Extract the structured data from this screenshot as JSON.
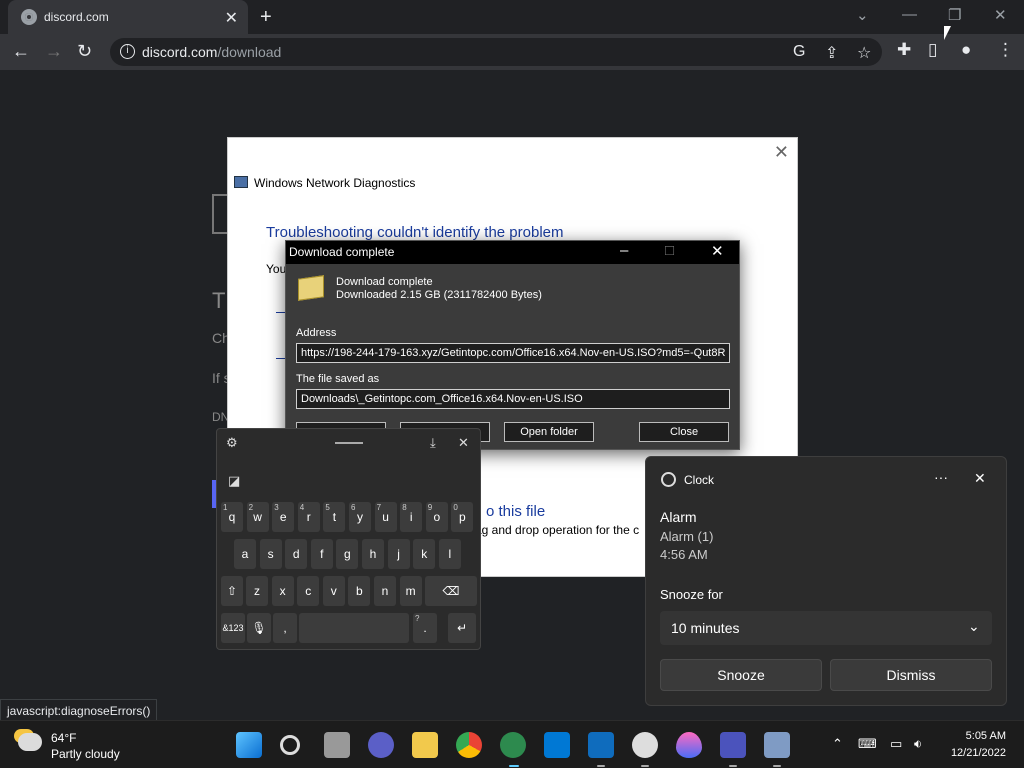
{
  "browser": {
    "tab_title": "discord.com",
    "url_host": "discord.com",
    "url_path": "/download",
    "colors": {
      "frame": "#202124",
      "toolbar": "#35363a"
    }
  },
  "diagnostics": {
    "title": "Windows Network Diagnostics",
    "heading": "Troubleshooting couldn't identify the problem",
    "body_start": "You",
    "link_text": "o this file",
    "drag_text": "rag and drop operation for the c"
  },
  "page_fragments": {
    "a": "T",
    "b": "Ch",
    "c": "If s",
    "d": "DN"
  },
  "download": {
    "title": "Download complete",
    "status": "Download complete",
    "detail": "Downloaded 2.15  GB (2311782400 Bytes)",
    "address_label": "Address",
    "address_value": "https://198-244-179-163.xyz/Getintopc.com/Office16.x64.Nov-en-US.ISO?md5=-Qut8R",
    "saved_label": "The file saved as",
    "saved_value": "Downloads\\_Getintopc.com_Office16.x64.Nov-en-US.ISO",
    "open_folder_label": "Open folder",
    "close_label": "Close"
  },
  "keyboard": {
    "row1": [
      {
        "k": "q",
        "n": "1"
      },
      {
        "k": "w",
        "n": "2"
      },
      {
        "k": "e",
        "n": "3"
      },
      {
        "k": "r",
        "n": "4"
      },
      {
        "k": "t",
        "n": "5"
      },
      {
        "k": "y",
        "n": "6"
      },
      {
        "k": "u",
        "n": "7"
      },
      {
        "k": "i",
        "n": "8"
      },
      {
        "k": "o",
        "n": "9"
      },
      {
        "k": "p",
        "n": "0"
      }
    ],
    "row2": [
      "a",
      "s",
      "d",
      "f",
      "g",
      "h",
      "j",
      "k",
      "l"
    ],
    "row3": [
      "z",
      "x",
      "c",
      "v",
      "b",
      "n",
      "m"
    ],
    "num_label": "&123",
    "comma": ",",
    "period": ".",
    "question": "?"
  },
  "clock": {
    "app_name": "Clock",
    "alarm_title": "Alarm",
    "alarm_name": "Alarm (1)",
    "alarm_time": "4:56 AM",
    "snooze_label": "Snooze for",
    "snooze_value": "10 minutes",
    "snooze_button": "Snooze",
    "dismiss_button": "Dismiss"
  },
  "status_bar": "javascript:diagnoseErrors()",
  "taskbar": {
    "weather_temp": "64°F",
    "weather_cond": "Partly cloudy",
    "time": "5:05 AM",
    "date": "12/21/2022"
  }
}
